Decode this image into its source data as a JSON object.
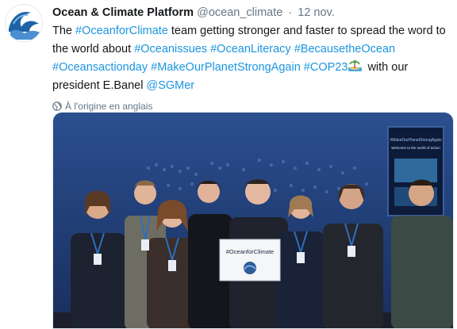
{
  "tweet": {
    "author_name": "Ocean & Climate Platform",
    "author_handle": "@ocean_climate",
    "separator": "·",
    "date": "12 nov.",
    "text_parts": {
      "p1": "The ",
      "h1": "#OceanforClimate",
      "p2": " team getting stronger and faster to spread the word to the world about ",
      "h2": "#Oceanissues",
      "h3": "#OceanLiteracy",
      "h4": "#BecausetheOcean",
      "h5": "#Oceansactionday",
      "h6": "#MakeOurPlanetStrongAgain",
      "h7": "#COP23",
      "p3": " with our president E.Banel ",
      "m1": "@SGMer"
    },
    "translate_label": "À l'origine en anglais",
    "emoji_icon": "island-emoji-icon"
  },
  "photo": {
    "sign_text": "#OceanforClimate",
    "screen_text": "#MakeOurPlanetStrongAgain",
    "screen_caption": "Welcome to the world of action",
    "colors": {
      "backdrop": "#1f3f7a",
      "backdrop_dark": "#142a55",
      "floor": "#1c1f2b"
    }
  },
  "colors": {
    "link": "#1b95e0",
    "muted": "#657786",
    "text": "#14171a"
  }
}
